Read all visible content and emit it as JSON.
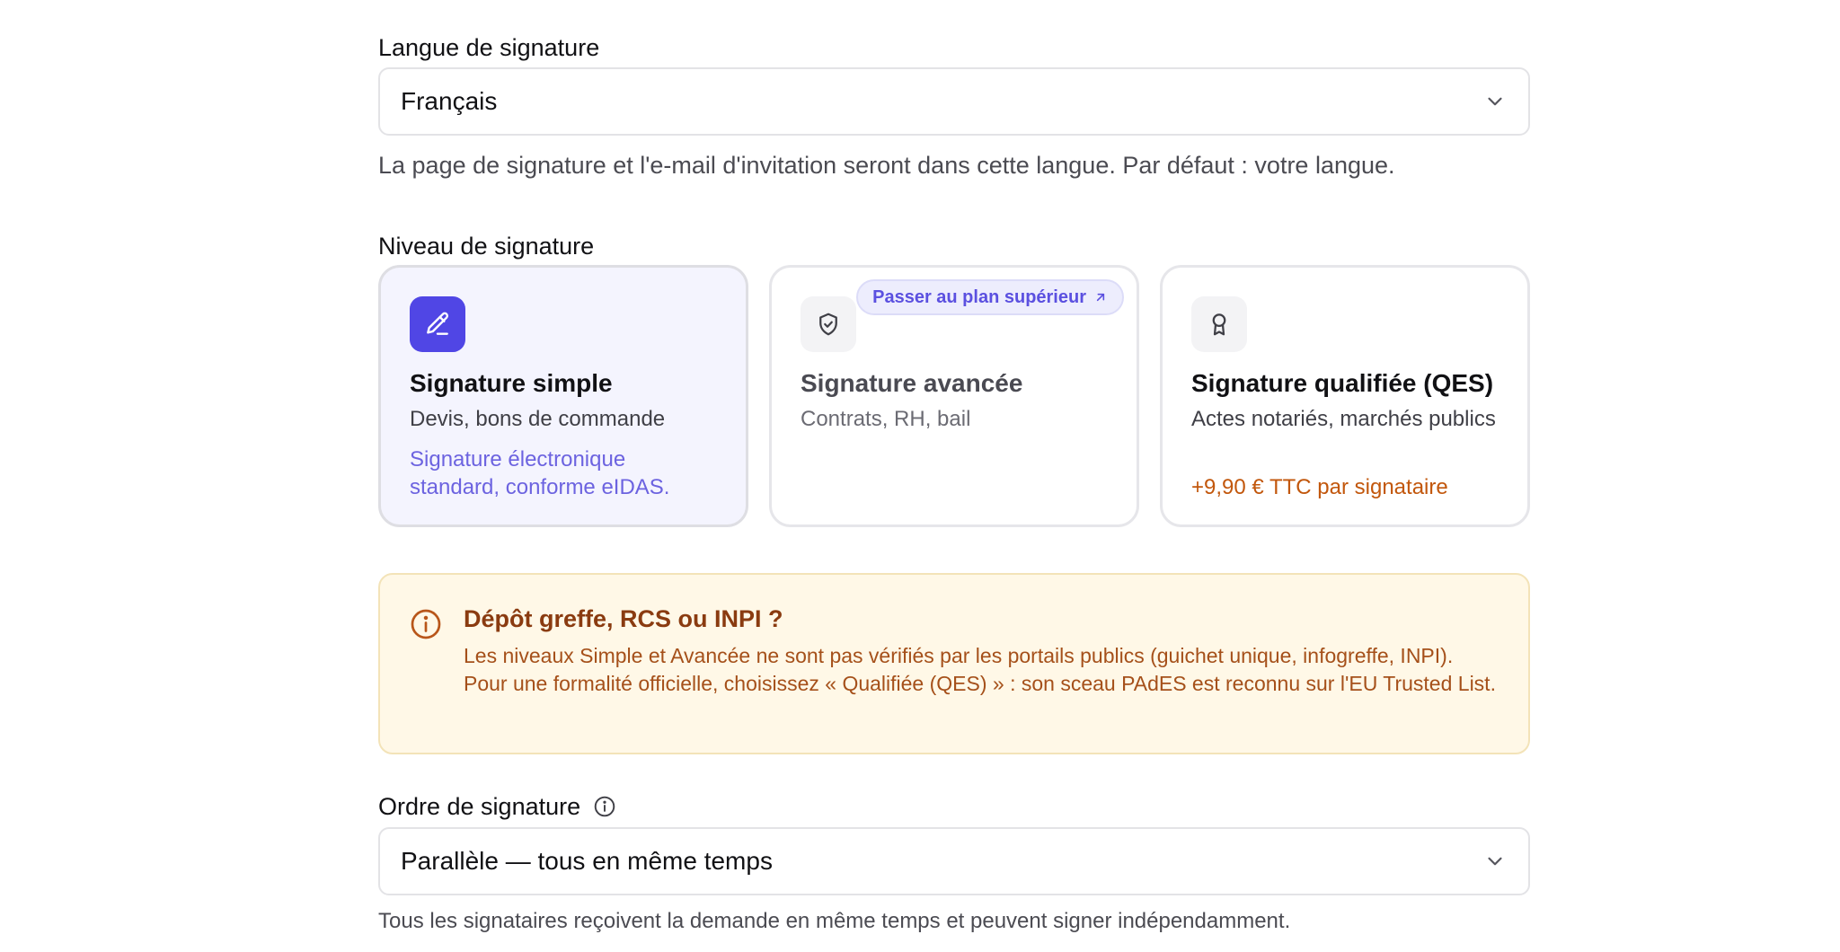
{
  "language": {
    "label": "Langue de signature",
    "value": "Français",
    "help": "La page de signature et l'e-mail d'invitation seront dans cette langue. Par défaut : votre langue."
  },
  "level": {
    "label": "Niveau de signature",
    "cards": [
      {
        "title": "Signature simple",
        "subtitle": "Devis, bons de commande",
        "note": "Signature électronique standard, conforme eIDAS.",
        "icon": "pen-icon",
        "selected": true,
        "note_color": "#6c63e0"
      },
      {
        "title": "Signature avancée",
        "subtitle": "Contrats, RH, bail",
        "badge": "Passer au plan supérieur",
        "icon": "shield-check-icon",
        "selected": false
      },
      {
        "title": "Signature qualifiée (QES)",
        "subtitle": "Actes notariés, marchés publics",
        "note": "+9,90 € TTC par signataire",
        "icon": "award-icon",
        "selected": false,
        "note_color": "#c2570c"
      }
    ]
  },
  "alert": {
    "title": "Dépôt greffe, RCS ou INPI ?",
    "body": "Les niveaux Simple et Avancée ne sont pas vérifiés par les portails publics (guichet unique, infogreffe, INPI). Pour une formalité officielle, choisissez « Qualifiée (QES) » : son sceau PAdES est reconnu sur l'EU Trusted List.",
    "icon": "info-icon"
  },
  "order": {
    "label": "Ordre de signature",
    "value": "Parallèle — tous en même temps",
    "help": "Tous les signataires reçoivent la demande en même temps et peuvent signer indépendamment."
  },
  "colors": {
    "accent": "#5046e5",
    "selected_card_bg": "#f4f4fe",
    "alert_bg": "#fff8e7",
    "alert_text": "#a5501a"
  }
}
